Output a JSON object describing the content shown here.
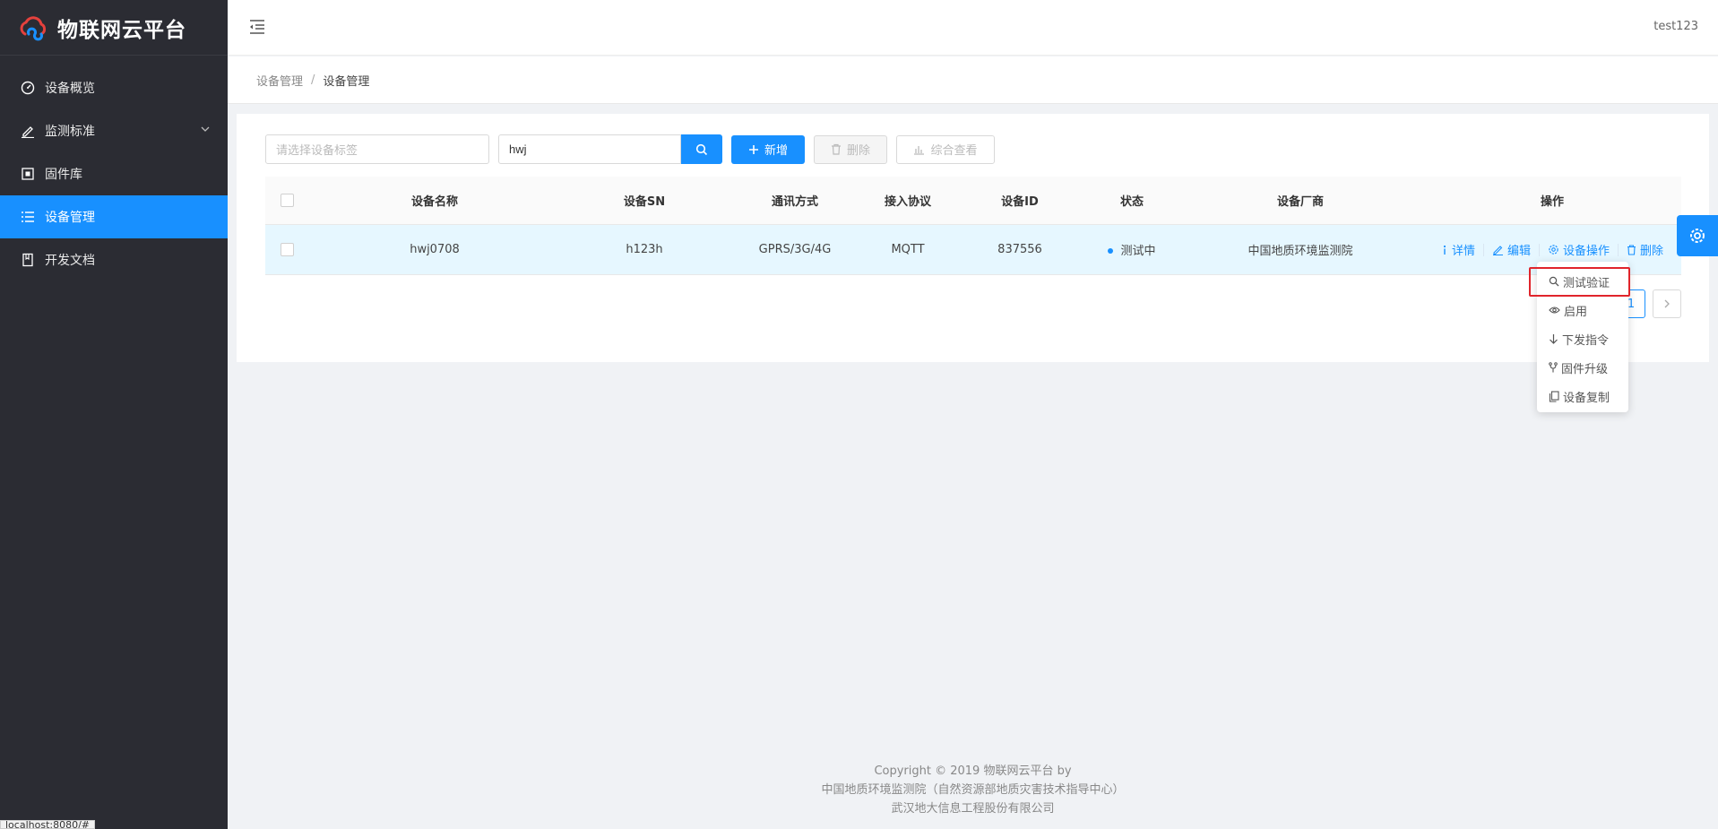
{
  "app": {
    "title": "物联网云平台"
  },
  "sidebar": {
    "items": [
      {
        "label": "设备概览",
        "icon": "dashboard-icon"
      },
      {
        "label": "监测标准",
        "icon": "edit-icon"
      },
      {
        "label": "固件库",
        "icon": "firmware-icon"
      },
      {
        "label": "设备管理",
        "icon": "list-icon",
        "active": true
      },
      {
        "label": "开发文档",
        "icon": "book-icon"
      }
    ]
  },
  "header": {
    "user": "test123"
  },
  "breadcrumb": {
    "parent": "设备管理",
    "separator": "/",
    "current": "设备管理"
  },
  "toolbar": {
    "tag_placeholder": "请选择设备标签",
    "search_value": "hwj",
    "add_label": "新增",
    "delete_label": "删除",
    "overview_label": "综合查看"
  },
  "table": {
    "columns": [
      "设备名称",
      "设备SN",
      "通讯方式",
      "接入协议",
      "设备ID",
      "状态",
      "设备厂商",
      "操作"
    ],
    "rows": [
      {
        "name": "hwj0708",
        "sn": "h123h",
        "comm": "GPRS/3G/4G",
        "protocol": "MQTT",
        "id": "837556",
        "status": "测试中",
        "vendor": "中国地质环境监测院",
        "ops": {
          "detail": "详情",
          "edit": "编辑",
          "device_ops": "设备操作",
          "delete": "删除"
        }
      }
    ]
  },
  "pagination": {
    "current": "1"
  },
  "dropdown": {
    "items": [
      {
        "label": "测试验证",
        "icon": "search-icon"
      },
      {
        "label": "启用",
        "icon": "eye-icon"
      },
      {
        "label": "下发指令",
        "icon": "arrow-down-icon"
      },
      {
        "label": "固件升级",
        "icon": "fork-icon"
      },
      {
        "label": "设备复制",
        "icon": "copy-icon"
      }
    ]
  },
  "footer": {
    "line1": "Copyright © 2019 物联网云平台    by",
    "line2": "中国地质环境监测院（自然资源部地质灾害技术指导中心）",
    "line3": "武汉地大信息工程股份有限公司"
  },
  "status_url": "localhost:8080/#",
  "colors": {
    "primary": "#1890ff",
    "sidebar": "#2b2c33",
    "highlight": "#e0242b"
  }
}
